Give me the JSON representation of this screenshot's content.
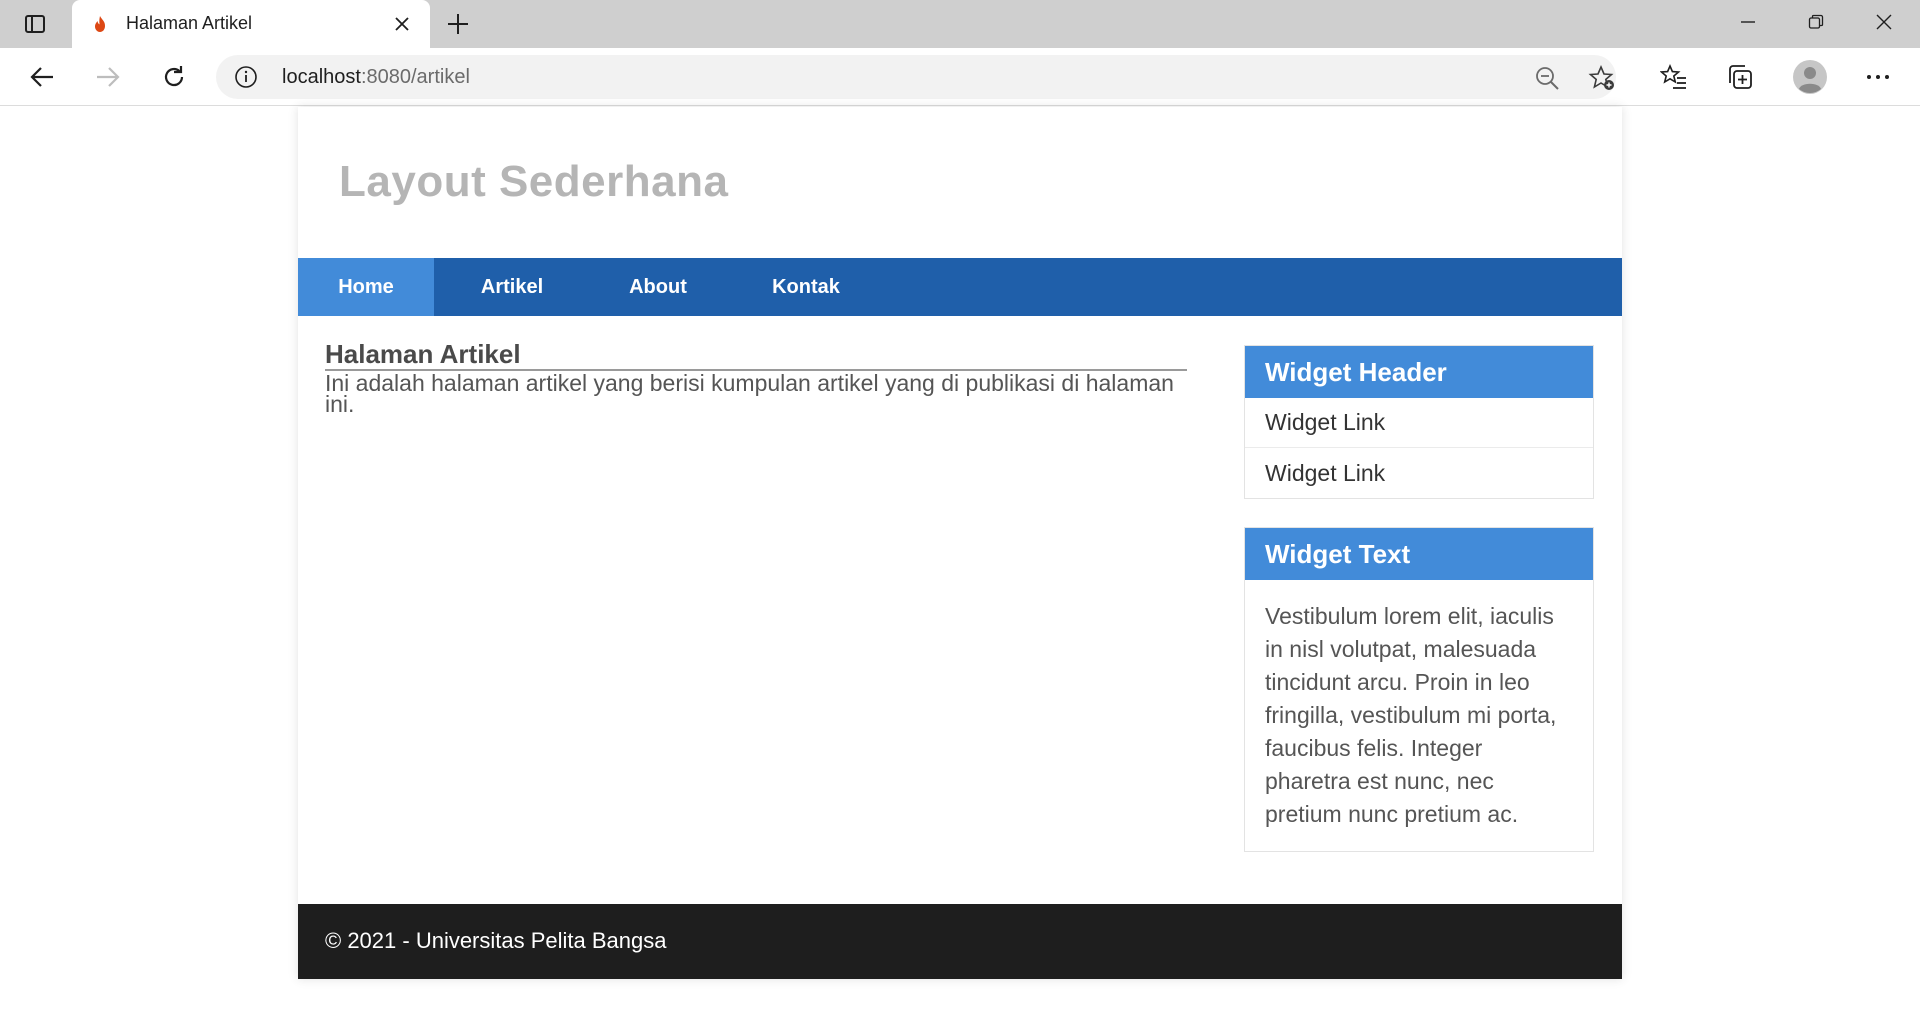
{
  "browser": {
    "tab_title": "Halaman Artikel",
    "url_host": "localhost",
    "url_rest": ":8080/artikel"
  },
  "site": {
    "title": "Layout Sederhana",
    "nav": [
      {
        "label": "Home",
        "active": true
      },
      {
        "label": "Artikel",
        "active": false
      },
      {
        "label": "About",
        "active": false
      },
      {
        "label": "Kontak",
        "active": false
      }
    ],
    "main": {
      "title": "Halaman Artikel",
      "text": "Ini adalah halaman artikel yang berisi kumpulan artikel yang di publikasi di halaman ini."
    },
    "widgets": {
      "header_title": "Widget Header",
      "links": [
        "Widget Link",
        "Widget Link"
      ],
      "text_title": "Widget Text",
      "text_body": "Vestibulum lorem elit, iaculis in nisl volutpat, malesuada tincidunt arcu. Proin in leo fringilla, vestibulum mi porta, faucibus felis. Integer pharetra est nunc, nec pretium nunc pretium ac."
    },
    "footer": "© 2021 - Universitas Pelita Bangsa"
  },
  "colors": {
    "nav_bg": "#1f5faa",
    "nav_active": "#428bd9",
    "widget_header": "#428bd9",
    "footer_bg": "#1e1e1e"
  }
}
